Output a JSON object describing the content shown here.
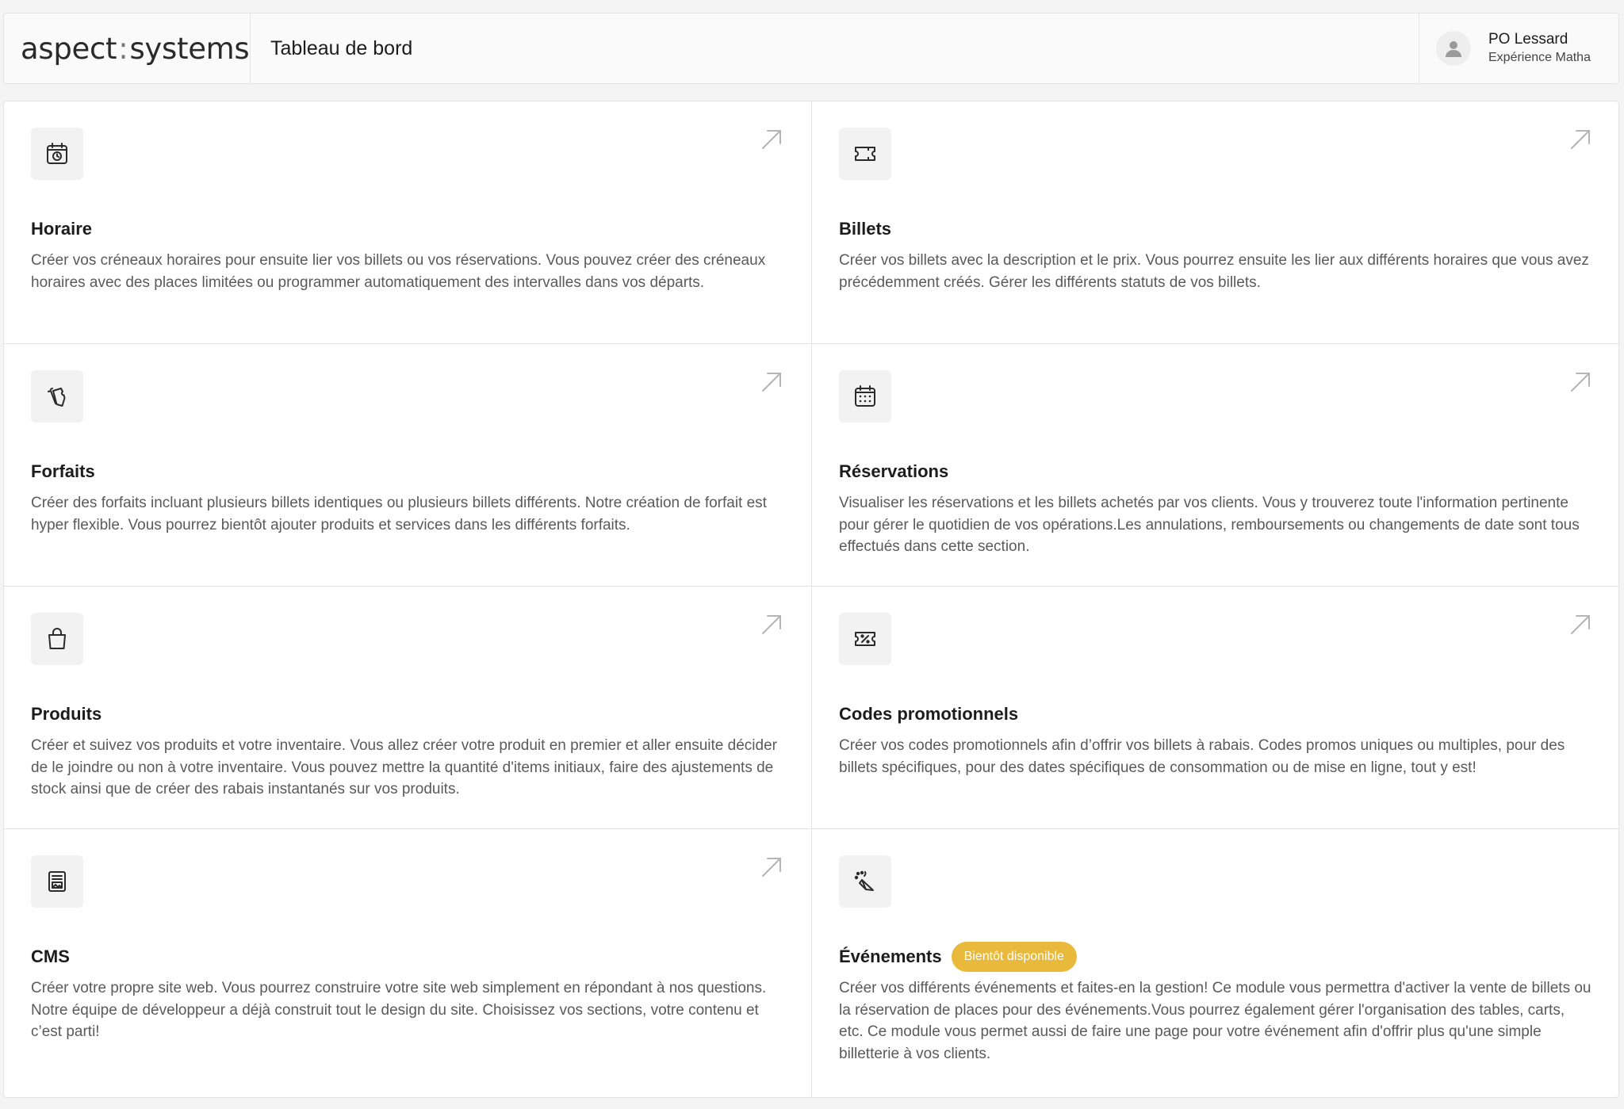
{
  "header": {
    "logo_part1": "aspect",
    "logo_sep": ":",
    "logo_part2": "systems",
    "page_title": "Tableau de bord",
    "user": {
      "name": "PO Lessard",
      "org": "Expérience Matha",
      "icon": "user-icon"
    }
  },
  "cards": [
    {
      "title": "Horaire",
      "icon": "calendar-clock-icon",
      "desc": "Créer vos créneaux horaires pour ensuite lier vos billets ou vos réservations. Vous pouvez créer des créneaux horaires avec des places limitées ou programmer automatiquement des intervalles dans vos départs."
    },
    {
      "title": "Billets",
      "icon": "ticket-icon",
      "desc": "Créer vos billets avec la description et le prix. Vous pourrez ensuite les lier aux différents horaires que vous avez précédemment créés. Gérer les différents statuts de vos billets."
    },
    {
      "title": "Forfaits",
      "icon": "tickets-stack-icon",
      "desc": "Créer des forfaits incluant plusieurs billets identiques ou plusieurs billets différents. Notre création de forfait est hyper flexible. Vous pourrez bientôt ajouter produits et services dans les différents forfaits."
    },
    {
      "title": "Réservations",
      "icon": "calendar-icon",
      "desc": "Visualiser les réservations et les billets achetés par vos clients. Vous y trouverez toute l'information pertinente pour gérer le quotidien de vos opérations.Les annulations, remboursements ou changements de date sont tous effectués dans cette section."
    },
    {
      "title": "Produits",
      "icon": "shopping-bag-icon",
      "desc": "Créer et suivez vos produits et votre inventaire. Vous allez créer votre produit en premier et aller ensuite décider de le joindre ou non à votre inventaire. Vous pouvez mettre la quantité d'items initiaux, faire des ajustements de stock ainsi que de créer des rabais instantanés sur vos produits."
    },
    {
      "title": "Codes promotionnels",
      "icon": "discount-ticket-icon",
      "desc": "Créer vos codes promotionnels afin d’offrir vos billets à rabais. Codes promos uniques ou multiples, pour des billets spécifiques, pour des dates spécifiques de consommation ou de mise en ligne, tout y est!"
    },
    {
      "title": "CMS",
      "icon": "document-image-icon",
      "desc": "Créer votre propre site web. Vous pourrez construire votre site web simplement en répondant à nos questions. Notre équipe de développeur a déjà construit tout le design du site. Choisissez vos sections, votre contenu et c’est parti!"
    },
    {
      "title": "Événements",
      "icon": "party-popper-icon",
      "badge": "Bientôt disponible",
      "desc": "Créer vos différents événements et faites-en la gestion! Ce module vous permettra d'activer la vente de billets ou la réservation de places pour des événements.Vous pourrez également gérer l'organisation des tables, carts, etc. Ce module vous permet aussi de faire une page pour votre événement afin d'offrir plus qu'une simple billetterie à vos clients."
    }
  ],
  "colors": {
    "badge": "#e8b93a",
    "border": "#e3e3e3",
    "background": "#f4f4f4"
  }
}
